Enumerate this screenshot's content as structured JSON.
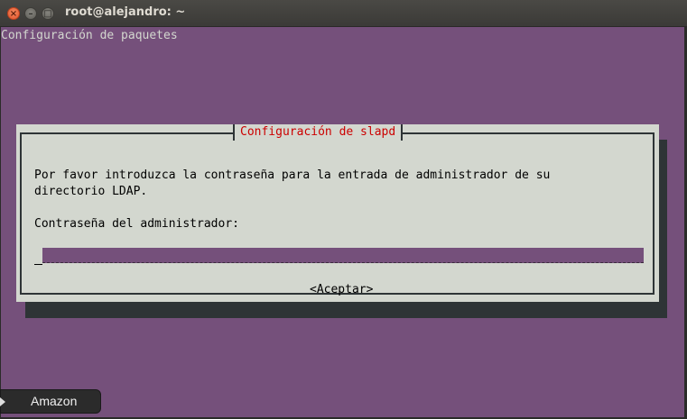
{
  "window": {
    "title": "root@alejandro: ~",
    "buttons": {
      "close_icon": "close-icon",
      "close_glyph": "×",
      "minimize_icon": "minimize-icon",
      "minimize_glyph": "–",
      "maximize_icon": "maximize-icon",
      "maximize_glyph": "□"
    }
  },
  "terminal": {
    "header": "Configuración de paquetes",
    "background_color": "#75507b"
  },
  "dialog": {
    "title": "Configuración de slapd",
    "message_line1": "Por favor introduzca la contraseña para la entrada de administrador de su",
    "message_line2": "directorio LDAP.",
    "field_label": "Contraseña del administrador:",
    "password_value": "",
    "ok_button": "<Aceptar>",
    "title_color": "#cc0000",
    "background_color": "#d3d7cf"
  },
  "launcher_tooltip": {
    "label": "Amazon"
  }
}
